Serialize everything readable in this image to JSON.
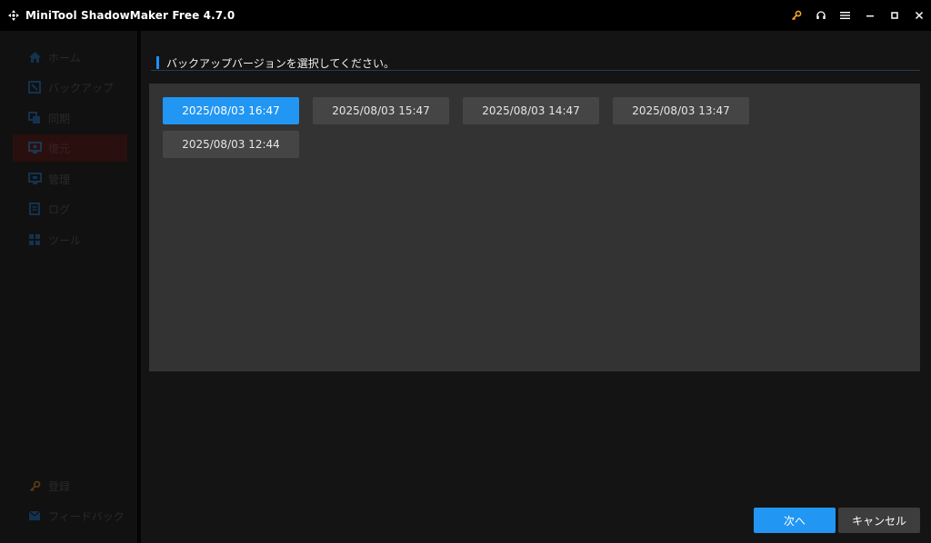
{
  "window": {
    "title": "MiniTool ShadowMaker Free 4.7.0"
  },
  "sidebar": {
    "items": [
      {
        "label": "ホーム",
        "icon": "home-icon"
      },
      {
        "label": "バックアップ",
        "icon": "backup-icon"
      },
      {
        "label": "同期",
        "icon": "sync-icon"
      },
      {
        "label": "復元",
        "icon": "restore-icon",
        "active": true
      },
      {
        "label": "管理",
        "icon": "manage-icon"
      },
      {
        "label": "ログ",
        "icon": "log-icon"
      },
      {
        "label": "ツール",
        "icon": "tools-icon"
      }
    ],
    "bottom": [
      {
        "label": "登録",
        "icon": "key-icon"
      },
      {
        "label": "フィードバック",
        "icon": "mail-icon"
      }
    ]
  },
  "main": {
    "section_title": "バックアップバージョンを選択してください。",
    "versions": [
      {
        "label": "2025/08/03 16:47",
        "selected": true
      },
      {
        "label": "2025/08/03 15:47",
        "selected": false
      },
      {
        "label": "2025/08/03 14:47",
        "selected": false
      },
      {
        "label": "2025/08/03 13:47",
        "selected": false
      },
      {
        "label": "2025/08/03 12:44",
        "selected": false
      }
    ],
    "next_label": "次へ",
    "cancel_label": "キャンセル"
  },
  "colors": {
    "accent": "#2196f3",
    "key_icon": "#f5a623"
  }
}
